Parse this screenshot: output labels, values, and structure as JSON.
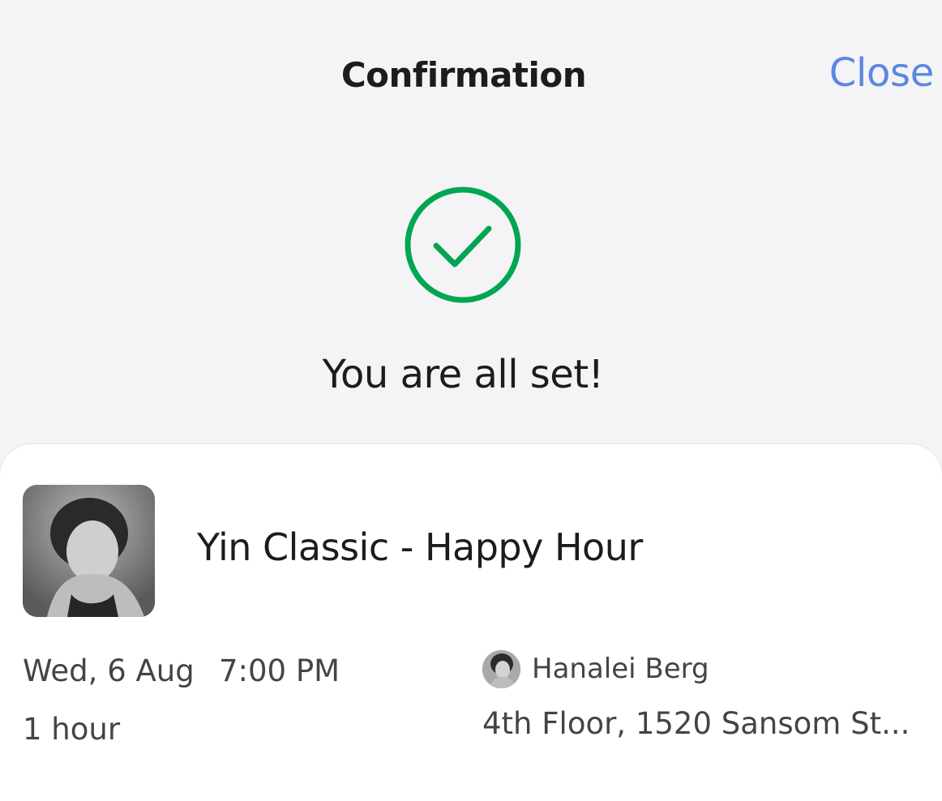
{
  "header": {
    "title": "Confirmation",
    "close_label": "Close"
  },
  "status": {
    "icon": "check-circle-icon",
    "message": "You are all set!",
    "accent_color": "#00a651"
  },
  "booking": {
    "class_name": "Yin Classic - Happy Hour",
    "date": "Wed, 6 Aug",
    "time": "7:00 PM",
    "duration": "1 hour",
    "instructor": "Hanalei Berg",
    "location": "4th Floor, 1520 Sansom St..."
  },
  "colors": {
    "link": "#5b87e3",
    "background": "#f4f4f6",
    "card": "#ffffff"
  }
}
